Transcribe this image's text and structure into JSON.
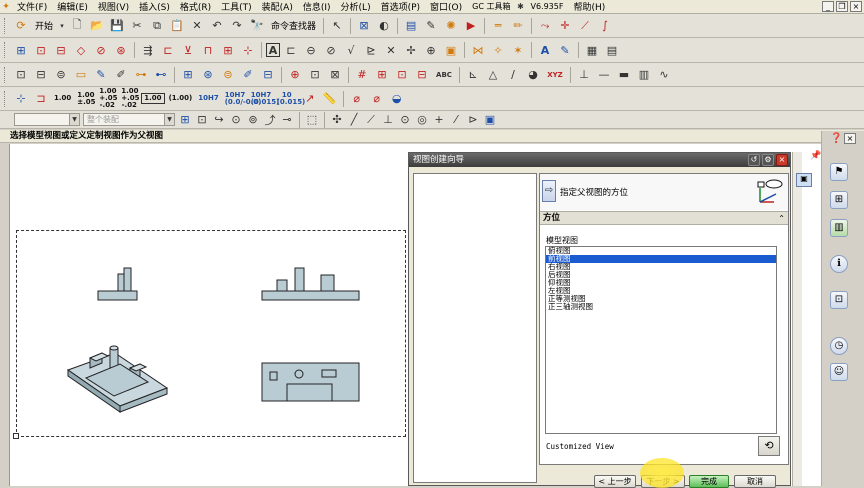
{
  "menubar": {
    "items": [
      "文件(F)",
      "编辑(E)",
      "视图(V)",
      "插入(S)",
      "格式(R)",
      "工具(T)",
      "装配(A)",
      "信息(I)",
      "分析(L)",
      "首选项(P)",
      "窗口(O)",
      "GC 工具箱",
      "帮助(H)"
    ],
    "version": "V6.935F"
  },
  "toolbar": {
    "start_label": "开始",
    "command_finder_label": "命令查找器",
    "dim_labels": [
      "1.00",
      "1.00 ±.05",
      "1.00 +.05 -.02",
      "1.00 +.05 -.02",
      "1.00",
      "(1.00)",
      "10H7",
      "10H7 (0.0/-0.0)",
      "10H7 (0.015)",
      "10 (0.015)"
    ],
    "abc_label": "ABC",
    "xyz_label": "XYZ"
  },
  "selection_bar": {
    "filter_value": "",
    "scope_value": "整个装配"
  },
  "cue_line": "选择模型视图或定义定制视图作为父视图",
  "dialog": {
    "title": "视图创建向导",
    "step_label": "指定父视图的方位",
    "section_title": "方位",
    "model_views_label": "模型视图",
    "views": [
      "俯视图",
      "前视图",
      "右视图",
      "后视图",
      "仰视图",
      "左视图",
      "正等测视图",
      "正三轴测视图"
    ],
    "selected_index": 1,
    "customized_label": "Customized View",
    "buttons": {
      "back": "< 上一步",
      "next": "下一步 >",
      "finish": "完成",
      "cancel": "取消"
    }
  },
  "colors": {
    "part_fill": "#b9ccd4",
    "selection_blue": "#1a5bd0",
    "finish_green": "#5cbf58"
  }
}
